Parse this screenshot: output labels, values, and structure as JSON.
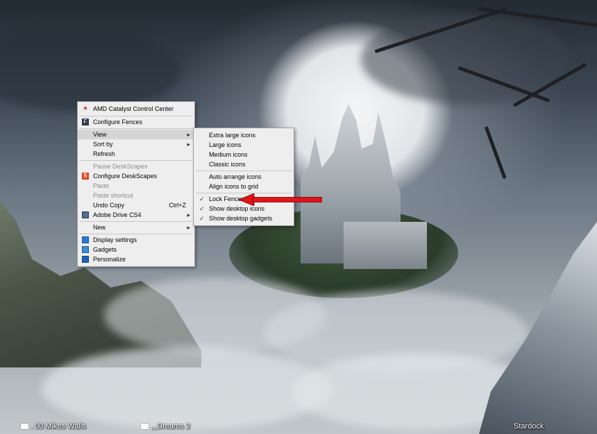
{
  "desktop": {
    "labels": [
      {
        "text": ". 00 Mikes Walls",
        "icon": "folder-icon"
      },
      {
        "text": ",,,Dreams 2",
        "icon": "folder-icon"
      },
      {
        "text": "Stardock"
      }
    ]
  },
  "context_menu": {
    "items": [
      {
        "label": "AMD Catalyst Control Center",
        "icon": "amd-icon"
      },
      {
        "label": "Configure Fences",
        "icon": "fences-icon"
      },
      {
        "label": "View",
        "has_submenu": true,
        "highlighted": true
      },
      {
        "label": "Sort by",
        "has_submenu": true
      },
      {
        "label": "Refresh"
      },
      {
        "label": "Pause DeskScapes",
        "disabled": true
      },
      {
        "label": "Configure DeskScapes",
        "icon": "deskscapes-icon"
      },
      {
        "label": "Paste",
        "disabled": true
      },
      {
        "label": "Paste shortcut",
        "disabled": true
      },
      {
        "label": "Undo Copy",
        "shortcut": "Ctrl+Z"
      },
      {
        "label": "Adobe Drive CS4",
        "icon": "adobe-drive-icon",
        "has_submenu": true
      },
      {
        "label": "New",
        "has_submenu": true
      },
      {
        "label": "Display settings",
        "icon": "display-settings-icon"
      },
      {
        "label": "Gadgets",
        "icon": "gadgets-icon"
      },
      {
        "label": "Personalize",
        "icon": "personalize-icon"
      }
    ]
  },
  "view_submenu": {
    "items": [
      {
        "label": "Extra large icons"
      },
      {
        "label": "Large icons"
      },
      {
        "label": "Medium icons"
      },
      {
        "label": "Classic icons"
      },
      {
        "label": "Auto arrange icons"
      },
      {
        "label": "Align icons to grid"
      },
      {
        "label": "Lock Fences",
        "checked": true
      },
      {
        "label": "Show desktop icons",
        "checked": true
      },
      {
        "label": "Show desktop gadgets",
        "checked": true
      }
    ]
  },
  "annotation": {
    "arrow_color": "#e0141b"
  },
  "colors": {
    "menu_bg": "#eeeeee",
    "menu_border": "#a0a0a0",
    "highlight": "#d5d5d5"
  }
}
